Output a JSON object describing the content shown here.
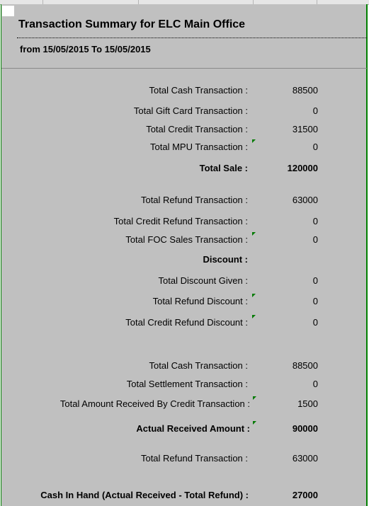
{
  "report": {
    "title": "Transaction Summary for ELC Main Office",
    "subtitle": "from 15/05/2015 To 15/05/2015"
  },
  "rows": [
    {
      "label": "Total Cash Transaction :",
      "value": "88500",
      "bold": false,
      "flag": false
    },
    {
      "label": "Total Gift Card Transaction :",
      "value": "0",
      "bold": false,
      "flag": false
    },
    {
      "label": "Total Credit Transaction :",
      "value": "31500",
      "bold": false,
      "flag": false
    },
    {
      "label": "Total MPU Transaction :",
      "value": "0",
      "bold": false,
      "flag": true
    },
    {
      "label": "Total Sale :",
      "value": "120000",
      "bold": true,
      "flag": false
    },
    {
      "label": "Total Refund Transaction :",
      "value": "63000",
      "bold": false,
      "flag": false
    },
    {
      "label": "Total Credit Refund Transaction :",
      "value": "0",
      "bold": false,
      "flag": false
    },
    {
      "label": "Total FOC Sales Transaction :",
      "value": "0",
      "bold": false,
      "flag": true
    },
    {
      "label": "Discount :",
      "value": "",
      "bold": true,
      "flag": false
    },
    {
      "label": "Total Discount Given :",
      "value": "0",
      "bold": false,
      "flag": false
    },
    {
      "label": "Total Refund Discount :",
      "value": "0",
      "bold": false,
      "flag": true
    },
    {
      "label": "Total Credit Refund Discount :",
      "value": "0",
      "bold": false,
      "flag": true
    },
    {
      "label": "Total Cash Transaction :",
      "value": "88500",
      "bold": false,
      "flag": false
    },
    {
      "label": "Total Settlement Transaction :",
      "value": "0",
      "bold": false,
      "flag": false
    },
    {
      "label": "Total Amount Received By Credit Transaction :",
      "value": "1500",
      "bold": false,
      "flag": true
    },
    {
      "label": "Actual Received Amount :",
      "value": "90000",
      "bold": true,
      "flag": true
    },
    {
      "label": "Total Refund Transaction :",
      "value": "63000",
      "bold": false,
      "flag": false
    },
    {
      "label": "Cash In Hand (Actual Received - Total Refund) :",
      "value": "27000",
      "bold": true,
      "flag": false
    }
  ]
}
